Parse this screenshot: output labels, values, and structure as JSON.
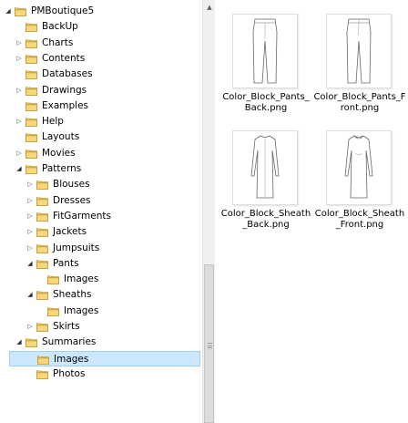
{
  "tree": [
    {
      "label": "PMBoutique5",
      "depth": 0,
      "arrow": "expanded",
      "selected": false
    },
    {
      "label": "BackUp",
      "depth": 1,
      "arrow": "none",
      "selected": false
    },
    {
      "label": "Charts",
      "depth": 1,
      "arrow": "collapsed",
      "selected": false
    },
    {
      "label": "Contents",
      "depth": 1,
      "arrow": "collapsed",
      "selected": false
    },
    {
      "label": "Databases",
      "depth": 1,
      "arrow": "none",
      "selected": false
    },
    {
      "label": "Drawings",
      "depth": 1,
      "arrow": "collapsed",
      "selected": false
    },
    {
      "label": "Examples",
      "depth": 1,
      "arrow": "none",
      "selected": false
    },
    {
      "label": "Help",
      "depth": 1,
      "arrow": "collapsed",
      "selected": false
    },
    {
      "label": "Layouts",
      "depth": 1,
      "arrow": "none",
      "selected": false
    },
    {
      "label": "Movies",
      "depth": 1,
      "arrow": "collapsed",
      "selected": false
    },
    {
      "label": "Patterns",
      "depth": 1,
      "arrow": "expanded",
      "selected": false
    },
    {
      "label": "Blouses",
      "depth": 2,
      "arrow": "collapsed",
      "selected": false
    },
    {
      "label": "Dresses",
      "depth": 2,
      "arrow": "collapsed",
      "selected": false
    },
    {
      "label": "FitGarments",
      "depth": 2,
      "arrow": "collapsed",
      "selected": false
    },
    {
      "label": "Jackets",
      "depth": 2,
      "arrow": "collapsed",
      "selected": false
    },
    {
      "label": "Jumpsuits",
      "depth": 2,
      "arrow": "collapsed",
      "selected": false
    },
    {
      "label": "Pants",
      "depth": 2,
      "arrow": "expanded",
      "selected": false
    },
    {
      "label": "Images",
      "depth": 3,
      "arrow": "none",
      "selected": false
    },
    {
      "label": "Sheaths",
      "depth": 2,
      "arrow": "expanded",
      "selected": false
    },
    {
      "label": "Images",
      "depth": 3,
      "arrow": "none",
      "selected": false
    },
    {
      "label": "Skirts",
      "depth": 2,
      "arrow": "collapsed",
      "selected": false
    },
    {
      "label": "Summaries",
      "depth": 1,
      "arrow": "expanded",
      "selected": false
    },
    {
      "label": "Images",
      "depth": 2,
      "arrow": "none",
      "selected": true
    },
    {
      "label": "Photos",
      "depth": 2,
      "arrow": "none",
      "selected": false
    }
  ],
  "files": [
    {
      "name": "Color_Block_Pants_Back.png",
      "thumb": "pants-back"
    },
    {
      "name": "Color_Block_Pants_Front.png",
      "thumb": "pants-front"
    },
    {
      "name": "Color_Block_Sheath_Back.png",
      "thumb": "dress-back"
    },
    {
      "name": "Color_Block_Sheath_Front.png",
      "thumb": "dress-front"
    }
  ],
  "icons": {
    "folder": "folder-icon",
    "expanded": "triangle-down-icon",
    "collapsed": "triangle-right-icon",
    "scroll_up": "scroll-up-arrow-icon",
    "grip": "scrollbar-grip-icon"
  },
  "colors": {
    "selection_bg": "#cce8ff",
    "selection_border": "#99d1ff",
    "folder_yellow": "#e8c15a"
  }
}
